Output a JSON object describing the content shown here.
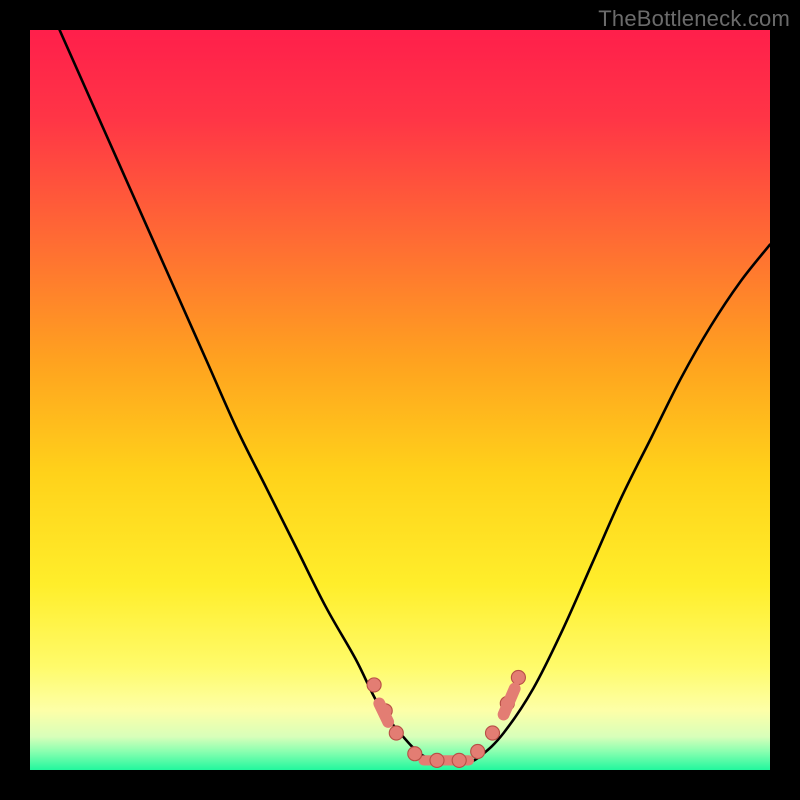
{
  "watermark": "TheBottleneck.com",
  "colors": {
    "frame": "#000000",
    "curve_stroke": "#000000",
    "marker_fill": "#e37d73",
    "marker_stroke": "#b84f46",
    "gradient_stops": [
      {
        "offset": 0.0,
        "color": "#ff1f4b"
      },
      {
        "offset": 0.12,
        "color": "#ff3546"
      },
      {
        "offset": 0.28,
        "color": "#ff6a34"
      },
      {
        "offset": 0.45,
        "color": "#ffa31f"
      },
      {
        "offset": 0.6,
        "color": "#ffd21a"
      },
      {
        "offset": 0.75,
        "color": "#ffee2b"
      },
      {
        "offset": 0.86,
        "color": "#fffb6a"
      },
      {
        "offset": 0.92,
        "color": "#fdffa8"
      },
      {
        "offset": 0.955,
        "color": "#d8ffba"
      },
      {
        "offset": 0.975,
        "color": "#8affb0"
      },
      {
        "offset": 1.0,
        "color": "#22f79e"
      }
    ]
  },
  "chart_data": {
    "type": "line",
    "title": "",
    "xlabel": "",
    "ylabel": "",
    "xlim": [
      0,
      100
    ],
    "ylim": [
      0,
      100
    ],
    "grid": false,
    "legend": false,
    "note": "Single V-shaped curve with a flat bottom. Both axes are unlabeled; values are estimated as percentages of the plot area (0–100). y≈0 is the green bottom band; y≈100 is the top edge.",
    "series": [
      {
        "name": "curve",
        "x": [
          4,
          8,
          12,
          16,
          20,
          24,
          28,
          32,
          36,
          40,
          44,
          47,
          50,
          53,
          56,
          59,
          61,
          64,
          68,
          72,
          76,
          80,
          84,
          88,
          92,
          96,
          100
        ],
        "y": [
          100,
          91,
          82,
          73,
          64,
          55,
          46,
          38,
          30,
          22,
          15,
          9,
          5,
          2,
          1,
          1,
          2,
          5,
          11,
          19,
          28,
          37,
          45,
          53,
          60,
          66,
          71
        ]
      }
    ],
    "markers": {
      "name": "highlighted-points",
      "note": "Salmon dots/segments near the curve minimum",
      "points": [
        {
          "x": 46.5,
          "y": 11.5
        },
        {
          "x": 48.0,
          "y": 8.0
        },
        {
          "x": 49.5,
          "y": 5.0
        },
        {
          "x": 52.0,
          "y": 2.2
        },
        {
          "x": 55.0,
          "y": 1.3
        },
        {
          "x": 58.0,
          "y": 1.3
        },
        {
          "x": 60.5,
          "y": 2.5
        },
        {
          "x": 62.5,
          "y": 5.0
        },
        {
          "x": 64.5,
          "y": 9.0
        },
        {
          "x": 66.0,
          "y": 12.5
        }
      ]
    }
  }
}
